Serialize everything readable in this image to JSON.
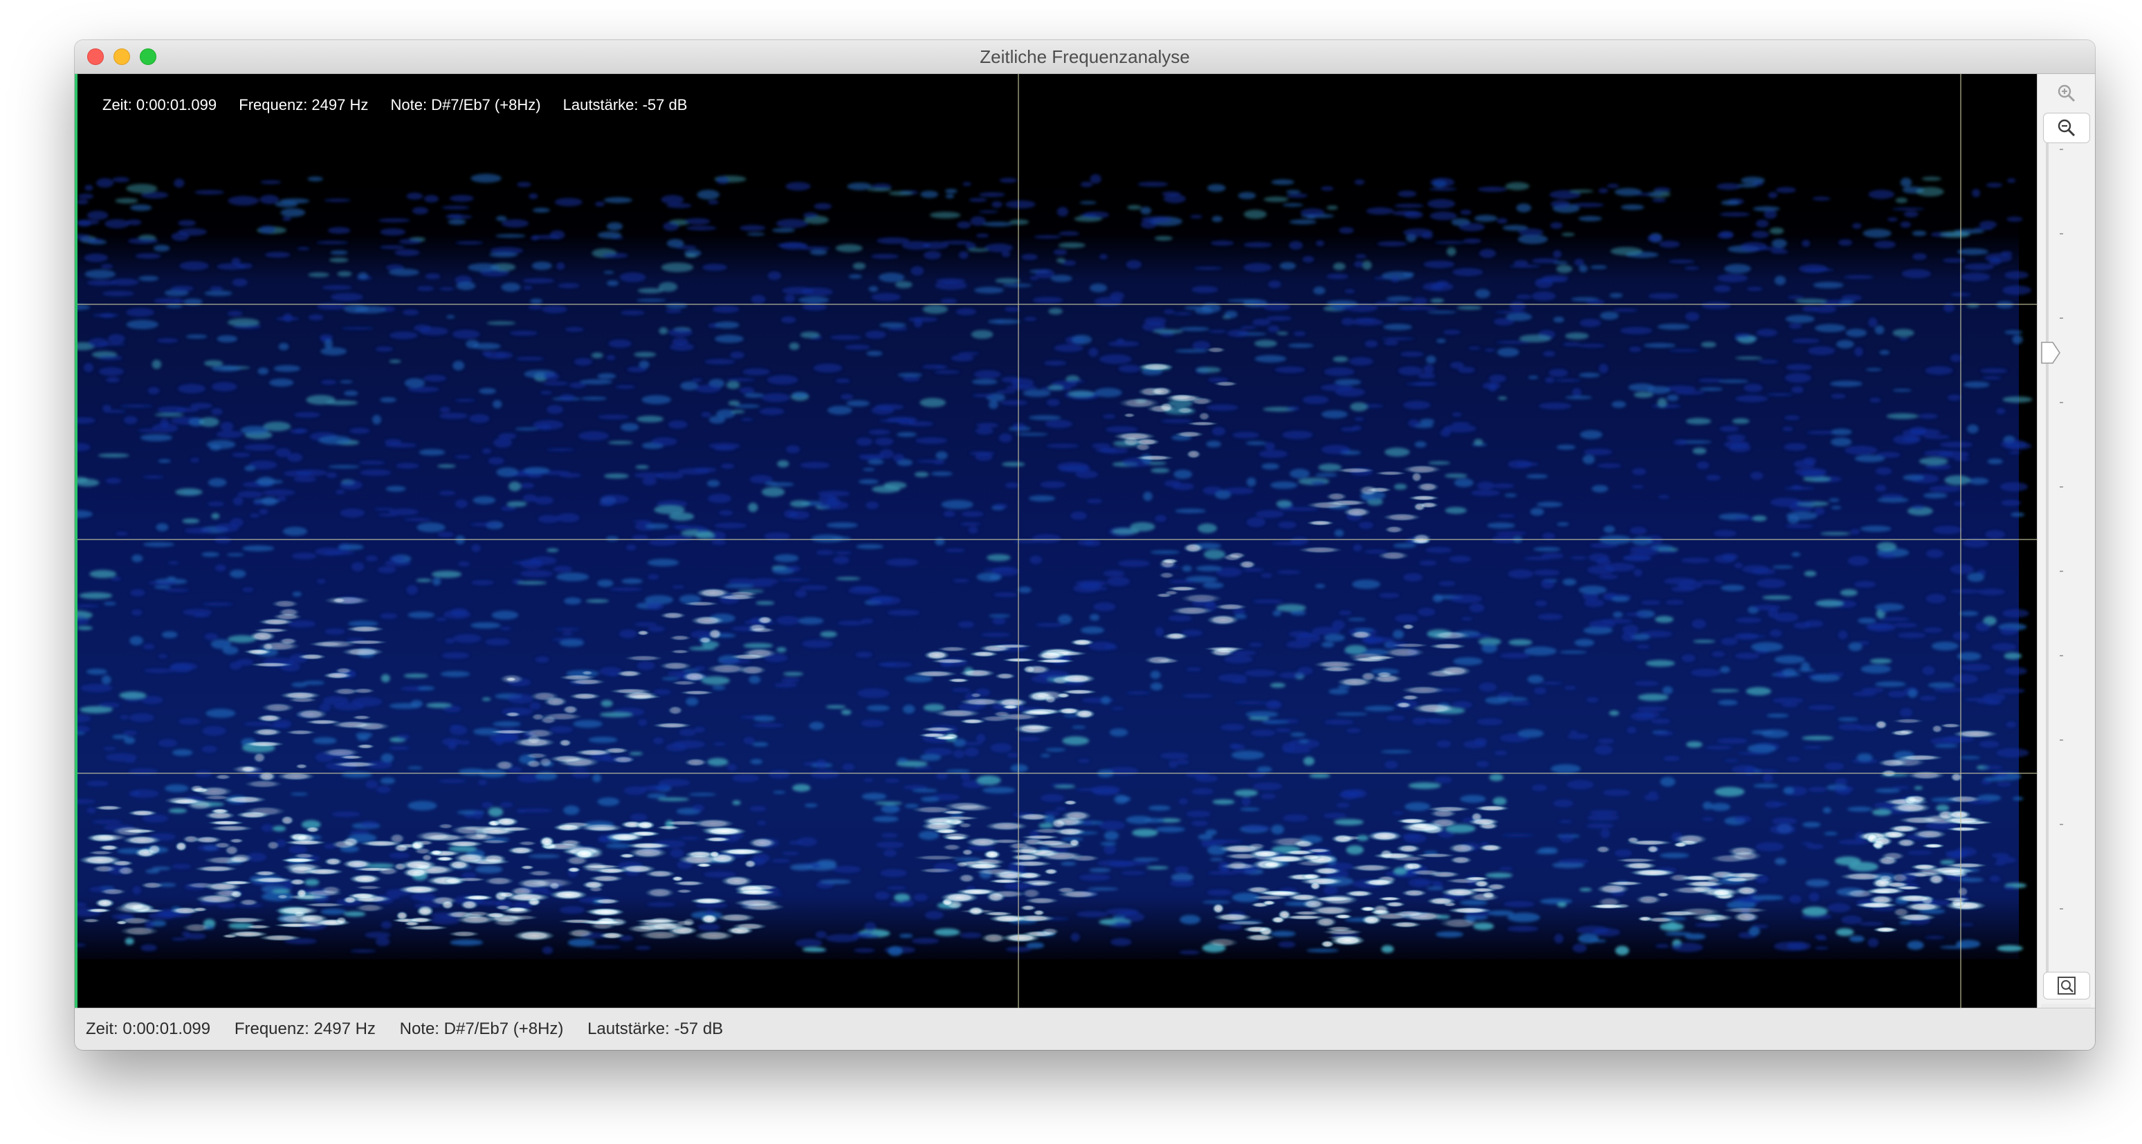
{
  "window": {
    "title": "Zeitliche Frequenzanalyse"
  },
  "readout": {
    "time": "Zeit: 0:00:01.099",
    "frequency": "Frequenz: 2497 Hz",
    "note": "Note: D#7/Eb7 (+8Hz)",
    "volume": "Lautstärke: -57 dB"
  },
  "statusbar": {
    "time": "Zeit: 0:00:01.099",
    "frequency": "Frequenz: 2497 Hz",
    "note": "Note: D#7/Eb7 (+8Hz)",
    "volume": "Lautstärke: -57 dB"
  },
  "sidebar": {
    "zoom_in_icon": "zoom-in-icon",
    "zoom_out_icon": "zoom-out-icon",
    "zoom_fit_icon": "zoom-fit-icon",
    "resolution_icon": "frequency-resolution-icon",
    "zoom_slider_level": 0.25
  },
  "colors": {
    "background": "#000000",
    "low_energy": "#0a1a6a",
    "mid_energy": "#2f7fa0",
    "high_energy": "#ffffff",
    "grid_line": "#c8c8a0"
  }
}
